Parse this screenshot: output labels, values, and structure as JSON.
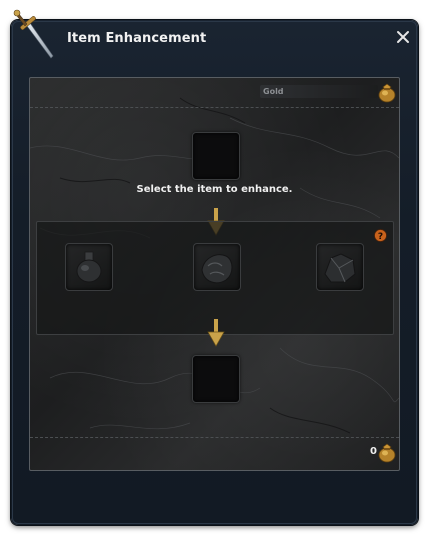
{
  "window": {
    "title": "Item Enhancement",
    "title_icon": "sword-icon",
    "close_icon": "close-icon"
  },
  "gold": {
    "label": "Gold",
    "value": "",
    "icon": "gold-bag-icon"
  },
  "enhance": {
    "instruction": "Select the item to enhance.",
    "help_icon": "help-icon",
    "materials": [
      {
        "icon": "potion-icon"
      },
      {
        "icon": "ore-icon"
      },
      {
        "icon": "crystal-ore-icon"
      }
    ]
  },
  "footer": {
    "gold_total": "0",
    "icon": "gold-bag-icon"
  },
  "colors": {
    "window_bg": "#141d28",
    "panel_border": "#585d62",
    "arrow_gold": "#c9a24a",
    "help_orange": "#c8621c",
    "text": "#f0f0f0"
  }
}
